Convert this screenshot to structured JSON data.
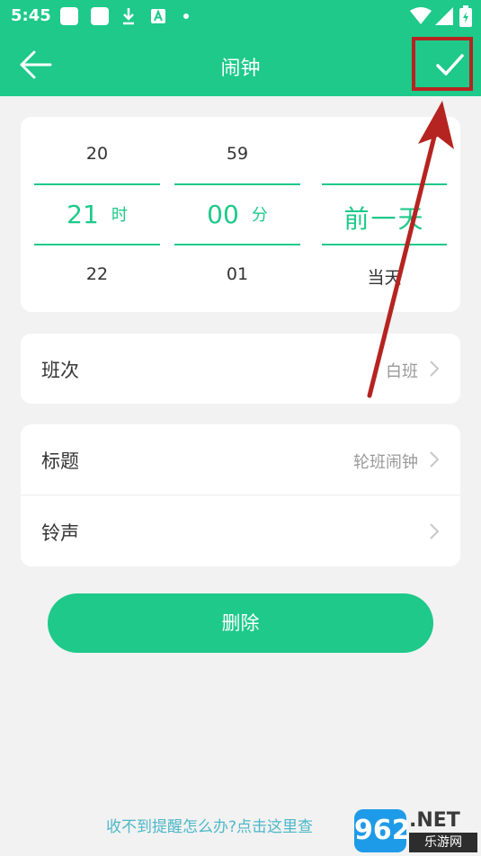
{
  "status_bar": {
    "time": "5:45",
    "icons": [
      "notification-square-icon",
      "notification-square-icon",
      "download-icon",
      "a-badge-icon",
      "dot-icon",
      "wifi-icon",
      "signal-icon",
      "battery-charging-icon"
    ]
  },
  "app_bar": {
    "title": "闹钟",
    "back_icon": "arrow-left-icon",
    "confirm_icon": "check-icon"
  },
  "picker": {
    "hour": {
      "prev": "20",
      "selected": "21",
      "unit": "时",
      "next": "22"
    },
    "minute": {
      "prev": "59",
      "selected": "00",
      "unit": "分",
      "next": "01"
    },
    "day": {
      "selected": "前一天",
      "next": "当天"
    }
  },
  "shift_row": {
    "label": "班次",
    "value": "白班"
  },
  "title_row": {
    "label": "标题",
    "value": "轮班闹钟"
  },
  "ringtone_row": {
    "label": "铃声",
    "value": ""
  },
  "delete_button": {
    "label": "删除"
  },
  "help_link": {
    "text": "收不到提醒怎么办?点击这里查"
  },
  "watermark": {
    "badge": "962",
    "domain": ".NET",
    "sub": "乐游网"
  },
  "colors": {
    "accent": "#1ec98a",
    "annotation": "#b52420",
    "link": "#4db8c8"
  }
}
